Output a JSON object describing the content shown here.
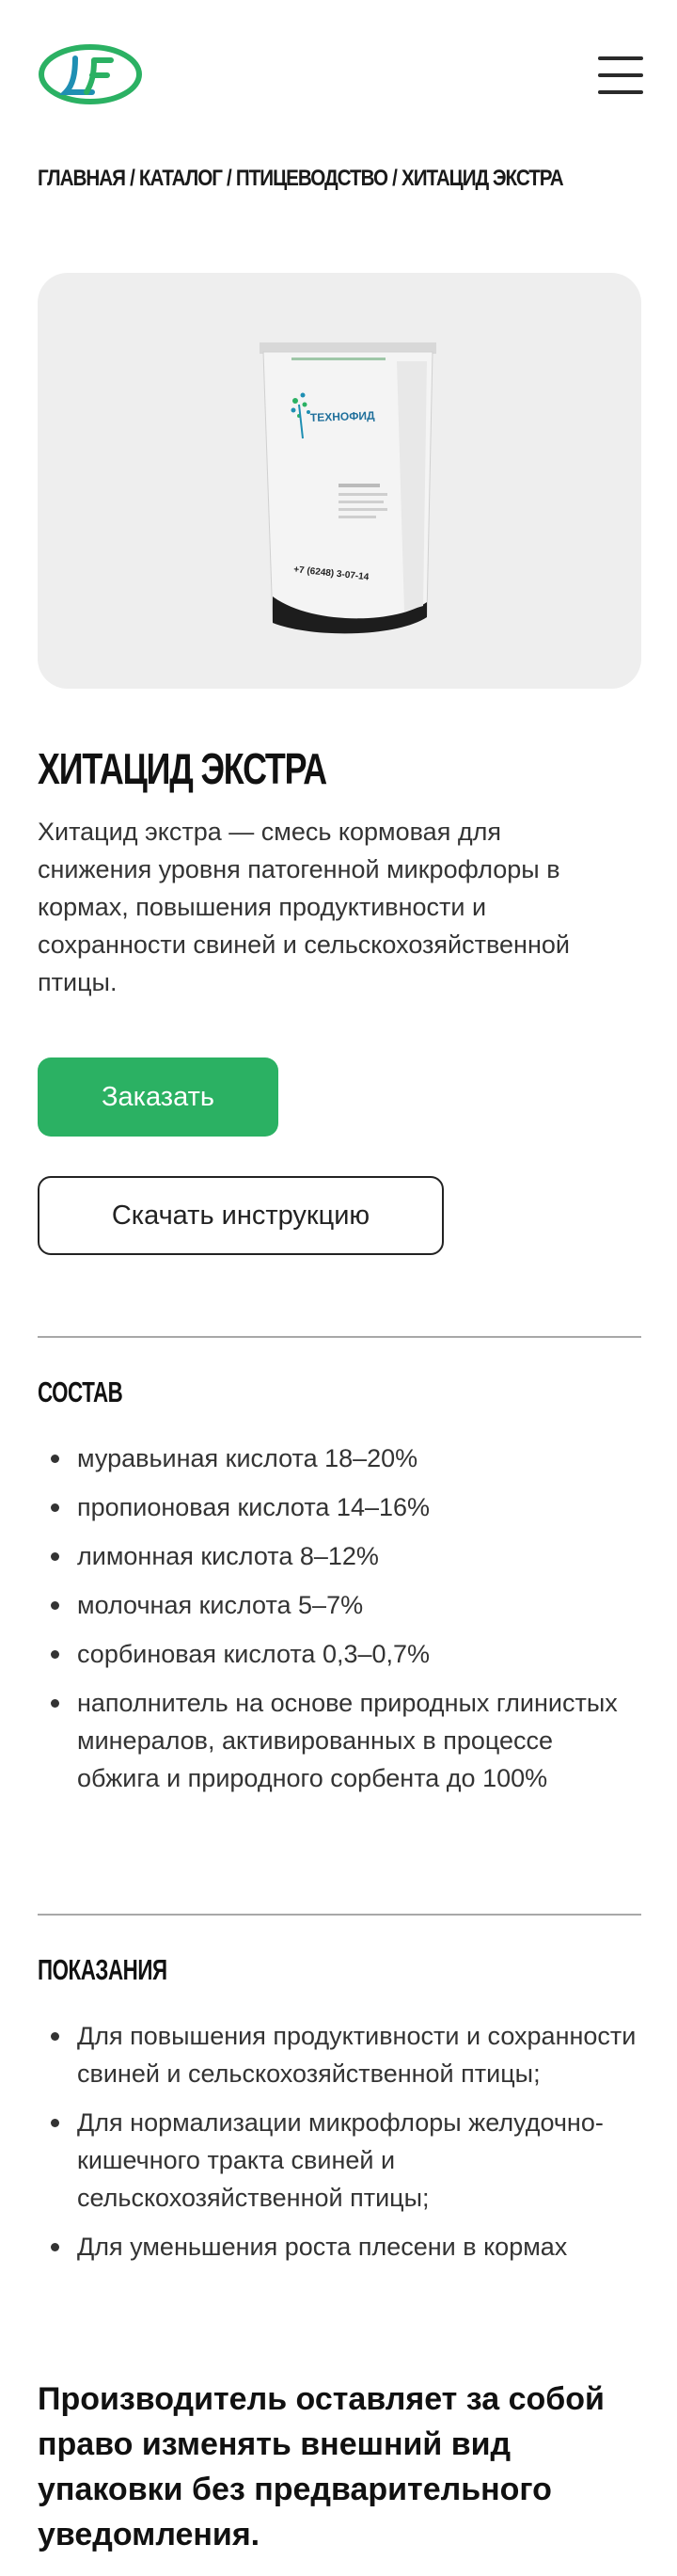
{
  "header": {
    "logo_icon": "lf-logo-icon",
    "menu_icon": "hamburger-menu-icon"
  },
  "breadcrumb": {
    "items": [
      "ГЛАВНАЯ",
      "КАТАЛОГ",
      "ПТИЦЕВОДСТВО",
      "ХИТАЦИД ЭКСТРА"
    ],
    "separator": "/"
  },
  "product": {
    "image_icon": "product-bag-image",
    "bag_phone": "+7 (6248) 3-07-14",
    "bag_brand": "ТЕХНОФИД",
    "title": "ХИТАЦИД ЭКСТРА",
    "description": "Хитацид экстра — смесь кормовая для снижения уровня патогенной микрофлоры в кормах, повышения продуктивности и сохранности свиней и сельскохозяйственной птицы."
  },
  "actions": {
    "order_label": "Заказать",
    "download_label": "Скачать инструкцию"
  },
  "composition": {
    "title": "СОСТАВ",
    "items": [
      "муравьиная кислота 18–20%",
      "пропионовая кислота 14–16%",
      "лимонная кислота 8–12%",
      "молочная кислота 5–7%",
      "сорбиновая кислота 0,3–0,7%",
      "наполнитель на основе природных глинистых минералов, активированных в процессе обжига и природного сорбента до 100%"
    ]
  },
  "indications": {
    "title": "ПОКАЗАНИЯ",
    "items": [
      "Для повышения продуктивности и сохранности свиней и сельскохозяйственной птицы;",
      "Для нормализации микрофлоры желудочно-кишечного тракта свиней и сельскохозяйственной птицы;",
      "Для уменьшения роста плесени в кормах"
    ]
  },
  "notice": "Производитель оставляет за собой право изменять внешний вид упаковки без предварительного уведомления.",
  "colors": {
    "accent": "#2bb163",
    "card_bg": "#eeeeee",
    "text": "#333333"
  }
}
